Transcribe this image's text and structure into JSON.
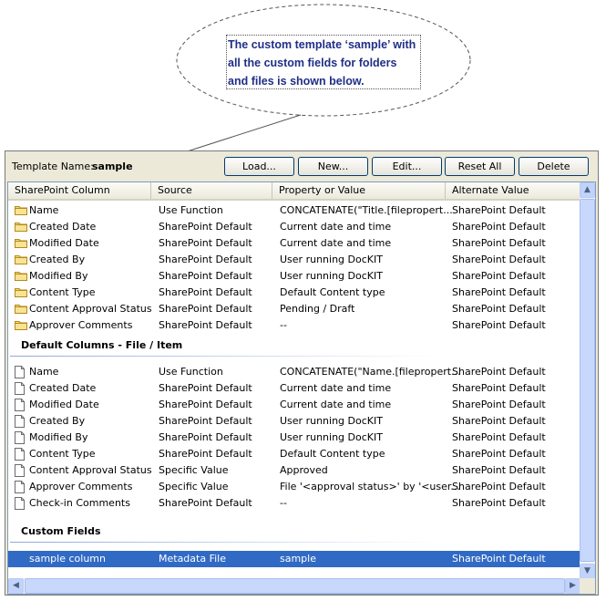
{
  "callout": {
    "text": "The custom template ‘sample’ with all the custom fields for folders and files is shown below."
  },
  "toolbar": {
    "template_name_label": "Template Name:",
    "template_name_value": "sample",
    "buttons": [
      {
        "label": "Load..."
      },
      {
        "label": "New..."
      },
      {
        "label": "Edit..."
      },
      {
        "label": "Reset All"
      },
      {
        "label": "Delete"
      }
    ]
  },
  "columns": [
    "SharePoint Column",
    "Source",
    "Property or Value",
    "Alternate Value"
  ],
  "folder_rows": [
    {
      "name": "Name",
      "source": "Use Function",
      "value": "CONCATENATE(\"Title.[filepropert...",
      "alt": "SharePoint Default"
    },
    {
      "name": "Created Date",
      "source": "SharePoint Default",
      "value": "Current date and time",
      "alt": "SharePoint Default"
    },
    {
      "name": "Modified Date",
      "source": "SharePoint Default",
      "value": "Current date and time",
      "alt": "SharePoint Default"
    },
    {
      "name": "Created By",
      "source": "SharePoint Default",
      "value": "User running DocKIT",
      "alt": "SharePoint Default"
    },
    {
      "name": "Modified By",
      "source": "SharePoint Default",
      "value": "User running DocKIT",
      "alt": "SharePoint Default"
    },
    {
      "name": "Content Type",
      "source": "SharePoint Default",
      "value": "Default Content type",
      "alt": "SharePoint Default"
    },
    {
      "name": "Content Approval Status",
      "source": "SharePoint Default",
      "value": "Pending / Draft",
      "alt": "SharePoint Default"
    },
    {
      "name": "Approver Comments",
      "source": "SharePoint Default",
      "value": "--",
      "alt": "SharePoint Default"
    }
  ],
  "group_file_title": "Default Columns - File / Item",
  "file_rows": [
    {
      "name": "Name",
      "source": "Use Function",
      "value": "CONCATENATE(\"Name.[filepropert...",
      "alt": "SharePoint Default"
    },
    {
      "name": "Created Date",
      "source": "SharePoint Default",
      "value": "Current date and time",
      "alt": "SharePoint Default"
    },
    {
      "name": "Modified Date",
      "source": "SharePoint Default",
      "value": "Current date and time",
      "alt": "SharePoint Default"
    },
    {
      "name": "Created By",
      "source": "SharePoint Default",
      "value": "User running DocKIT",
      "alt": "SharePoint Default"
    },
    {
      "name": "Modified By",
      "source": "SharePoint Default",
      "value": "User running DocKIT",
      "alt": "SharePoint Default"
    },
    {
      "name": "Content Type",
      "source": "SharePoint Default",
      "value": "Default Content type",
      "alt": "SharePoint Default"
    },
    {
      "name": "Content Approval Status",
      "source": "Specific Value",
      "value": "Approved",
      "alt": "SharePoint Default"
    },
    {
      "name": "Approver Comments",
      "source": "Specific Value",
      "value": "File '<approval status>' by '<user...",
      "alt": "SharePoint Default"
    },
    {
      "name": "Check-in Comments",
      "source": "SharePoint Default",
      "value": "--",
      "alt": "SharePoint Default"
    }
  ],
  "group_custom_title": "Custom Fields",
  "custom_rows": [
    {
      "name": "sample column",
      "source": "Metadata File",
      "value": "sample",
      "alt": "SharePoint Default",
      "selected": true
    }
  ],
  "icons": {
    "folder": "folder-icon",
    "document": "document-icon"
  },
  "colors": {
    "selection": "#316ac5",
    "callout_text": "#1f2f86"
  }
}
